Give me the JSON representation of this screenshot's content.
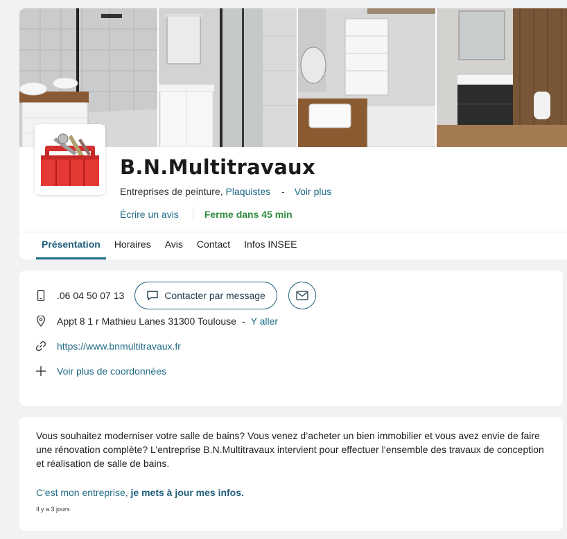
{
  "gallery": {
    "photos": [
      {
        "alt": "bathroom-photo-1"
      },
      {
        "alt": "bathroom-photo-2"
      },
      {
        "alt": "bathroom-photo-3"
      },
      {
        "alt": "bathroom-photo-4"
      }
    ]
  },
  "business": {
    "name": "B.N.Multitravaux",
    "category_primary": "Entreprises de peinture,",
    "category_secondary": "Plaquistes",
    "dash": "-",
    "see_more": "Voir plus",
    "write_review": "Écrire un avis",
    "status": "Ferme dans 45 min"
  },
  "tabs": [
    {
      "label": "Présentation",
      "active": true
    },
    {
      "label": "Horaires"
    },
    {
      "label": "Avis"
    },
    {
      "label": "Contact"
    },
    {
      "label": "Infos INSEE"
    }
  ],
  "contact": {
    "phone": ".06 04 50 07 13",
    "message_button": "Contacter par message",
    "address": "Appt 8 1 r Mathieu Lanes 31300 Toulouse",
    "address_dash": "-",
    "directions": "Y aller",
    "website": "https://www.bnmultitravaux.fr",
    "more_details": "Voir plus de coordonnées"
  },
  "description": {
    "text": "Vous souhaitez moderniser votre salle de bains? Vous venez d’acheter un bien immobilier et vous avez envie de faire une rénovation complète? L’entreprise B.N.Multitravaux intervient pour effectuer l’ensemble des travaux de conception et réalisation de salle de bains.",
    "owner_prefix": "C'est mon entreprise,",
    "owner_link": "je mets à jour mes infos.",
    "updated": "Il y a 3 jours"
  },
  "colors": {
    "accent": "#1f6a85",
    "status_open": "#2e8b3e",
    "background": "#f0f2f4"
  }
}
